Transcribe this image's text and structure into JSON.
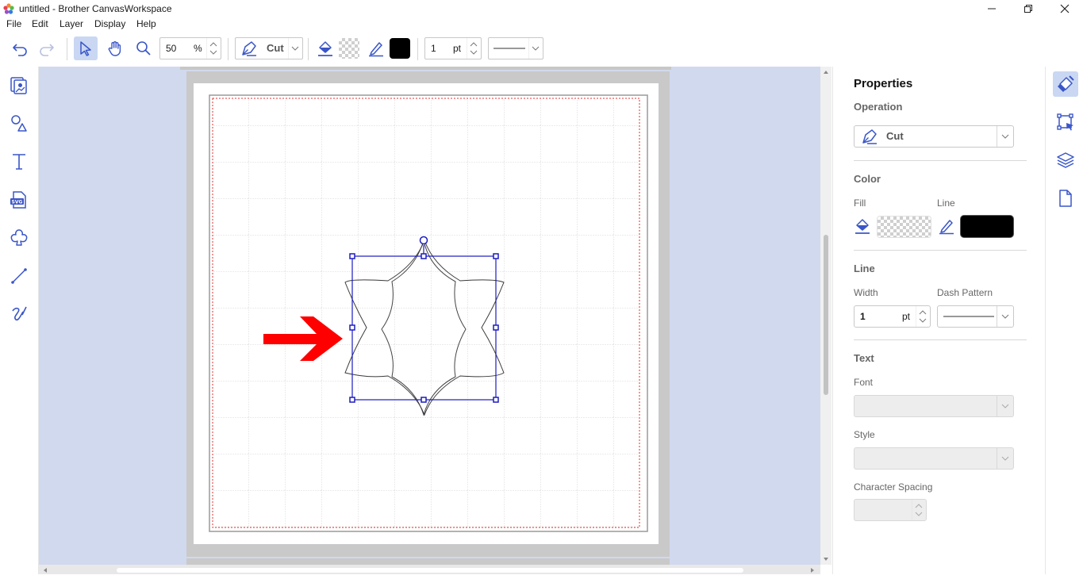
{
  "window": {
    "title": "untitled - Brother CanvasWorkspace"
  },
  "menu": {
    "items": [
      "File",
      "Edit",
      "Layer",
      "Display",
      "Help"
    ]
  },
  "toolbar": {
    "zoom_value": "50",
    "zoom_unit": "%",
    "operation": "Cut",
    "line_width_value": "1",
    "line_width_unit": "pt",
    "icons": [
      "undo-icon",
      "redo-icon",
      "select-icon",
      "hand-icon",
      "zoom-icon",
      "cut-pen-icon",
      "fill-bucket-icon",
      "pen-icon"
    ]
  },
  "left_sidebar": {
    "icons": [
      "templates-icon",
      "shapes-icon",
      "text-icon",
      "svg-import-icon",
      "image-trace-icon",
      "line-icon",
      "freehand-icon"
    ]
  },
  "right_sidebar": {
    "icons": [
      "properties-brush-icon",
      "transform-icon",
      "layers-icon",
      "page-icon"
    ]
  },
  "properties": {
    "title": "Properties",
    "operation_label": "Operation",
    "operation_value": "Cut",
    "color_label": "Color",
    "fill_label": "Fill",
    "line_color_label": "Line",
    "line_section_label": "Line",
    "width_label": "Width",
    "width_value": "1",
    "width_unit": "pt",
    "dash_label": "Dash Pattern",
    "text_label": "Text",
    "font_label": "Font",
    "style_label": "Style",
    "char_spacing_label": "Character Spacing"
  },
  "colors": {
    "accent": "#3a56c8",
    "selection": "#1c1cc0",
    "active_button": "#c9d7f2",
    "canvas_bg": "#d1d9ee",
    "cut_margin": "#e03030",
    "arrow": "#ff0000",
    "line_color": "#000000"
  }
}
